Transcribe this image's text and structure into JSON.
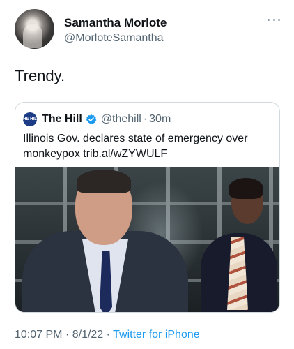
{
  "tweet": {
    "author_name": "Samantha Morlote",
    "author_handle": "@MorloteSamantha",
    "avatar_icon": "user-avatar",
    "more_icon": "more-horizontal-icon",
    "text": "Trendy.",
    "timestamp_time": "10:07 PM",
    "separator": "·",
    "timestamp_date": "8/1/22",
    "source": "Twitter for iPhone"
  },
  "quoted_tweet": {
    "avatar_text": "THE HILL",
    "name": "The Hill",
    "verified_icon": "verified-badge-icon",
    "handle": "@thehill",
    "separator": "·",
    "time": "30m",
    "text": "Illinois Gov. declares state of emergency over monkeypox trib.al/wZYWULF",
    "media": "photo"
  },
  "colors": {
    "text_primary": "#0f1419",
    "text_secondary": "#536471",
    "accent": "#1d9bf0",
    "border": "#cfd9de"
  }
}
